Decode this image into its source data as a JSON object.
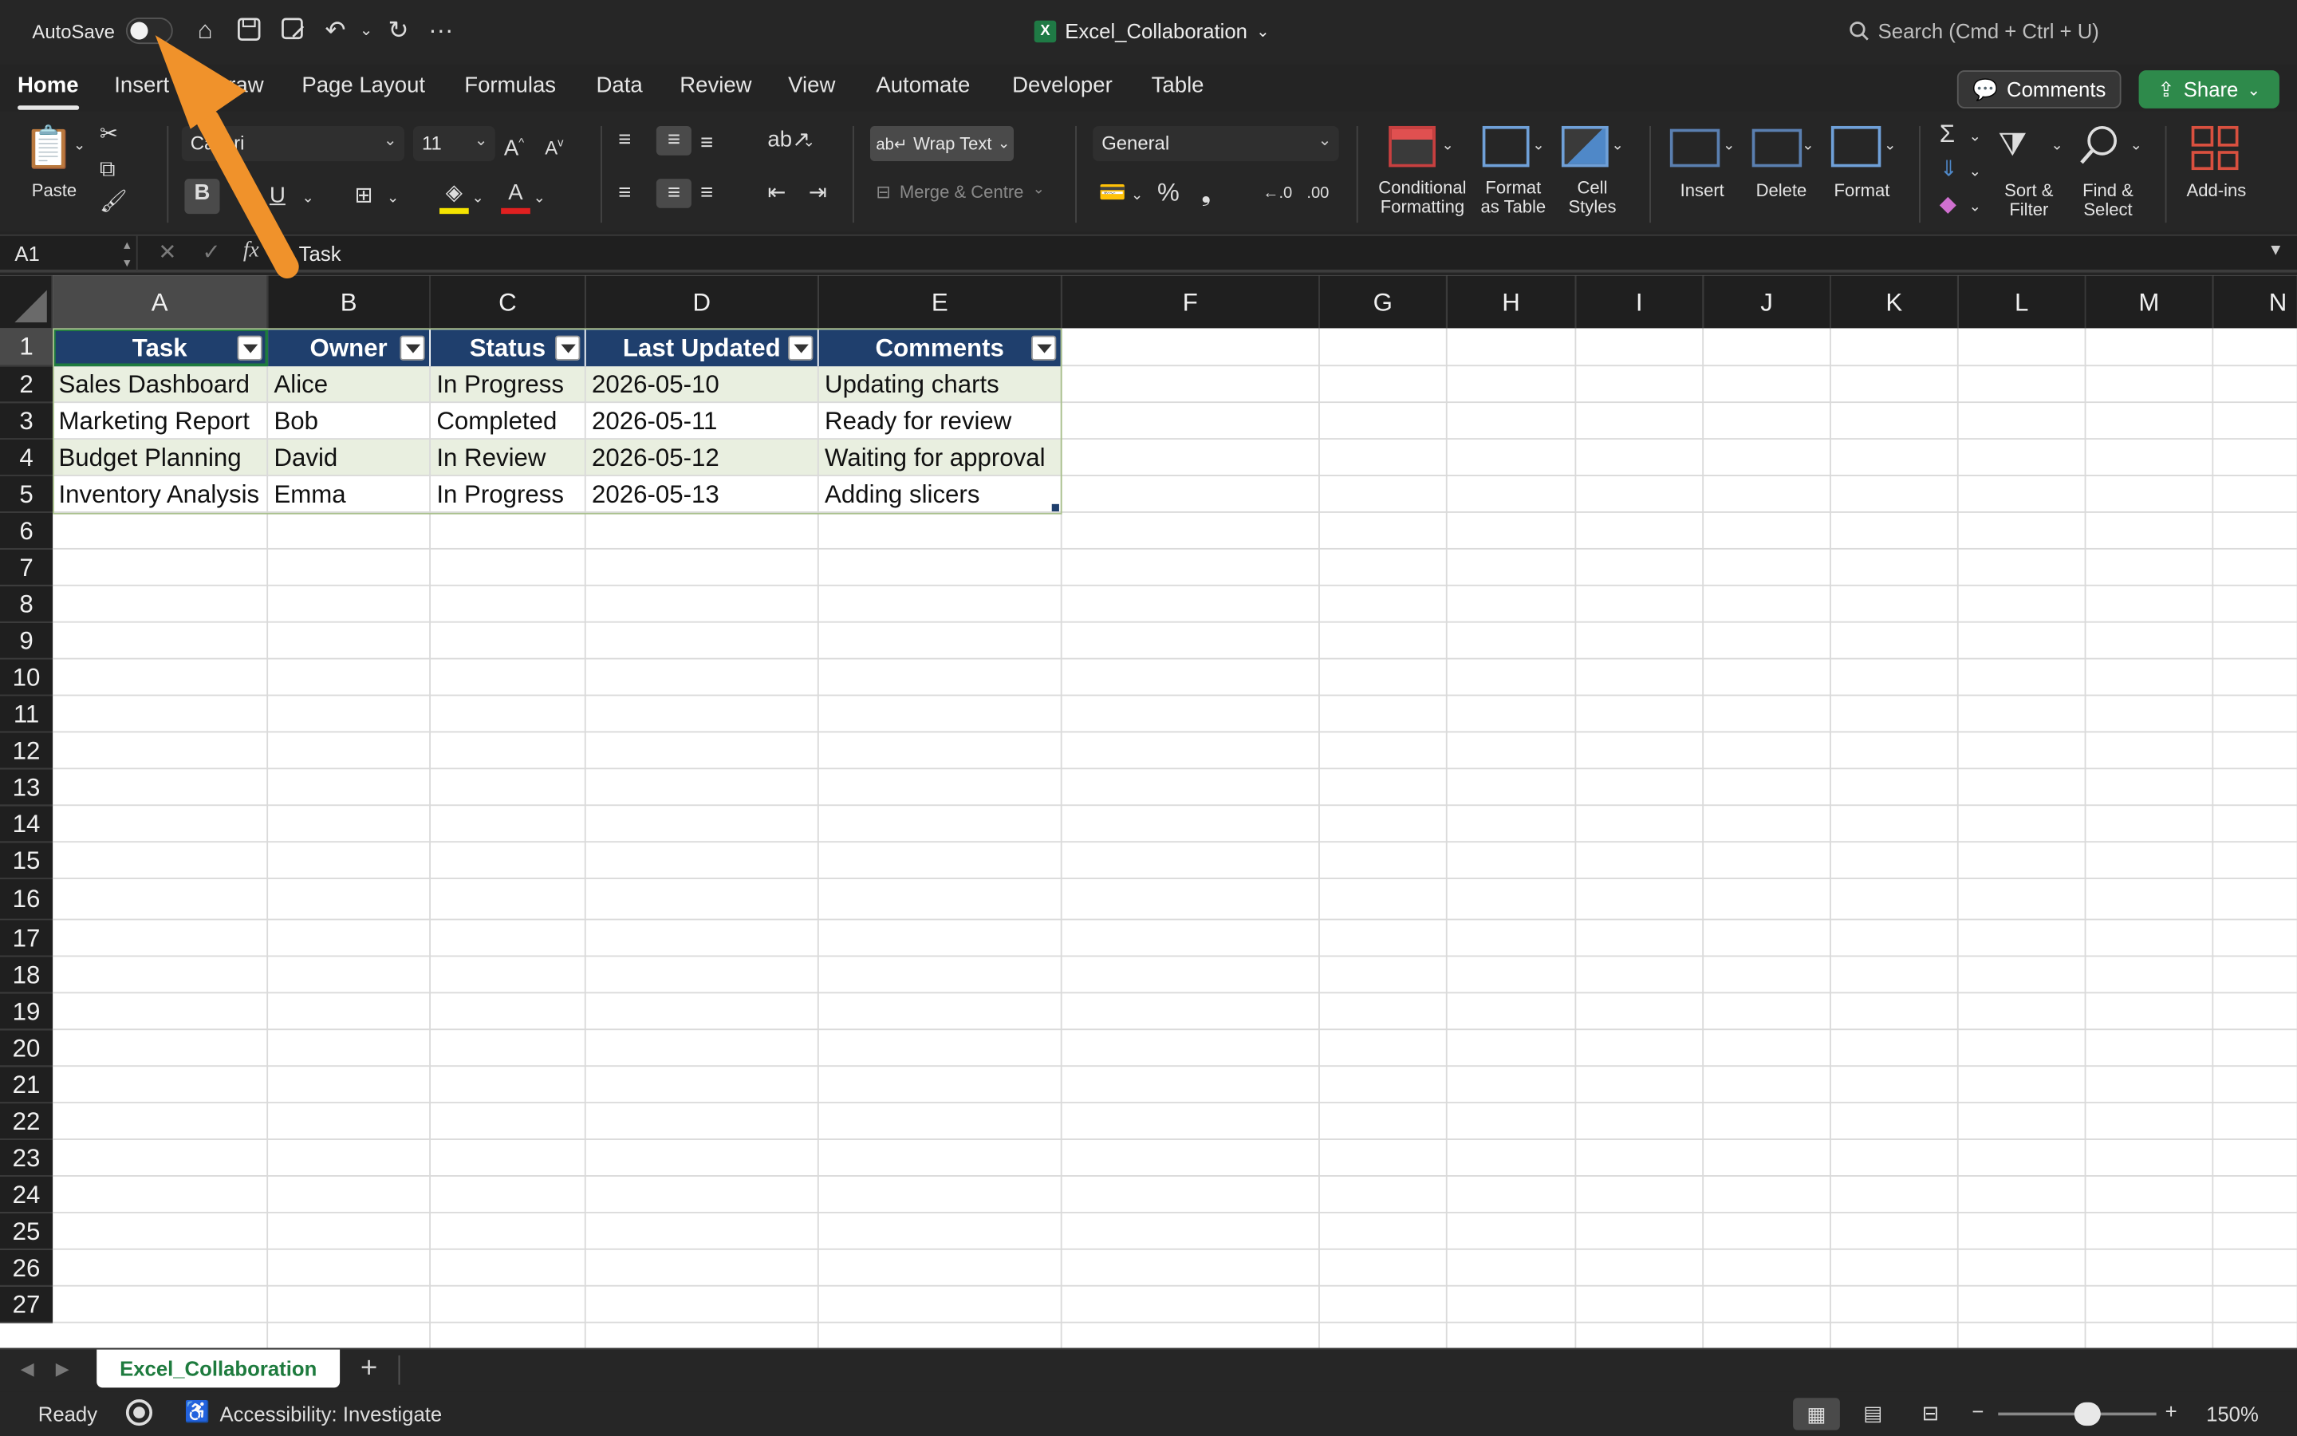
{
  "titlebar": {
    "autosave_label": "AutoSave",
    "window_title": "Excel_Collaboration",
    "search_placeholder": "Search (Cmd + Ctrl + U)"
  },
  "tabs": [
    "Home",
    "Insert",
    "Draw",
    "Page Layout",
    "Formulas",
    "Data",
    "Review",
    "View",
    "Automate",
    "Developer",
    "Table"
  ],
  "actions": {
    "comments": "Comments",
    "share": "Share"
  },
  "ribbon": {
    "paste": "Paste",
    "font_name": "Calibri",
    "font_size": "11",
    "wrap_text": "Wrap Text",
    "merge_centre": "Merge & Centre",
    "number_format": "General",
    "conditional_formatting": "Conditional Formatting",
    "format_as_table": "Format as Table",
    "cell_styles": "Cell Styles",
    "insert": "Insert",
    "delete": "Delete",
    "format": "Format",
    "sort_filter": "Sort & Filter",
    "find_select": "Find & Select",
    "addins": "Add-ins"
  },
  "formula_bar": {
    "cell_ref": "A1",
    "content": "Task",
    "fx": "fx"
  },
  "columns": [
    "A",
    "B",
    "C",
    "D",
    "E",
    "F",
    "G",
    "H",
    "I",
    "J",
    "K",
    "L",
    "M",
    "N"
  ],
  "rows": [
    "1",
    "2",
    "3",
    "4",
    "5",
    "6",
    "7",
    "8",
    "9",
    "10",
    "11",
    "12",
    "13",
    "14",
    "15",
    "16",
    "17",
    "18",
    "19",
    "20",
    "21",
    "22",
    "23",
    "24",
    "25",
    "26",
    "27"
  ],
  "table": {
    "headers": [
      "Task",
      "Owner",
      "Status",
      "Last Updated",
      "Comments"
    ],
    "rows": [
      [
        "Sales Dashboard",
        "Alice",
        "In Progress",
        "2026-05-10",
        "Updating charts"
      ],
      [
        "Marketing Report",
        "Bob",
        "Completed",
        "2026-05-11",
        "Ready for review"
      ],
      [
        "Budget Planning",
        "David",
        "In Review",
        "2026-05-12",
        "Waiting for approval"
      ],
      [
        "Inventory Analysis",
        "Emma",
        "In Progress",
        "2026-05-13",
        "Adding slicers"
      ]
    ]
  },
  "sheet": {
    "active_tab": "Excel_Collaboration",
    "add": "+"
  },
  "status": {
    "ready": "Ready",
    "accessibility": "Accessibility: Investigate",
    "zoom": "150%"
  },
  "colors": {
    "table_header": "#1f3f6d",
    "band": "#e9efe0",
    "share": "#2e8a4b",
    "annotation_arrow": "#f0922b"
  }
}
